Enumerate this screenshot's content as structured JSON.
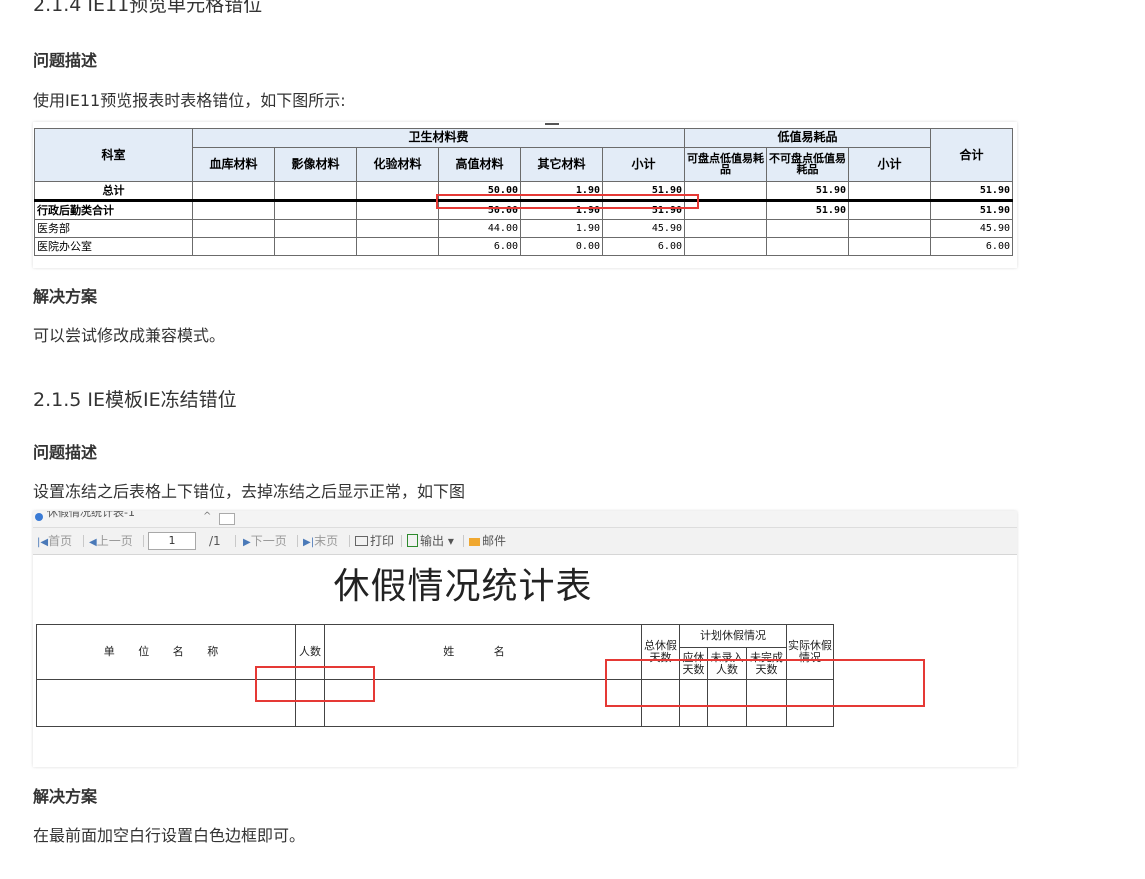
{
  "section_214": {
    "heading": "2.1.4 IE11预览单元格错位",
    "problem_heading": "问题描述",
    "problem_text": "使用IE11预览报表时表格错位，如下图所示:",
    "solution_heading": "解决方案",
    "solution_text": "可以尝试修改成兼容模式。"
  },
  "section_215": {
    "heading": "2.1.5 IE模板IE冻结错位",
    "problem_heading": "问题描述",
    "problem_text": "设置冻结之后表格上下错位，去掉冻结之后显示正常，如下图",
    "solution_heading": "解决方案",
    "solution_text": "在最前面加空白行设置白色边框即可。"
  },
  "report_table": {
    "header_dept": "科室",
    "header_health": "卫生材料费",
    "header_low": "低值易耗品",
    "header_total": "合计",
    "sub_headers": [
      "血库材料",
      "影像材料",
      "化验材料",
      "高值材料",
      "其它材料",
      "小计",
      "可盘点低值易耗品",
      "不可盘点低值易耗品",
      "小计"
    ],
    "rows": [
      {
        "name": "总计",
        "bold": true,
        "cells": [
          "",
          "",
          "",
          "50.00",
          "1.90",
          "51.90",
          "",
          "51.90",
          "",
          "51.90"
        ]
      },
      {
        "name": "行政后勤类合计",
        "bold": true,
        "cells": [
          "",
          "",
          "",
          "50.00",
          "1.90",
          "51.90",
          "",
          "51.90",
          "",
          "51.90"
        ]
      },
      {
        "name": "医务部",
        "bold": false,
        "cells": [
          "",
          "",
          "",
          "44.00",
          "1.90",
          "45.90",
          "",
          "",
          "",
          "45.90"
        ]
      },
      {
        "name": "医院办公室",
        "bold": false,
        "cells": [
          "",
          "",
          "",
          "6.00",
          "0.00",
          "6.00",
          "",
          "",
          "",
          "6.00"
        ]
      }
    ]
  },
  "leave_report": {
    "tab_title": "休假情况统计表-1",
    "toolbar": {
      "first": "首页",
      "prev": "上一页",
      "page_value": "1",
      "page_total": "/1",
      "next": "下一页",
      "last": "末页",
      "print": "打印",
      "export": "输出",
      "mail": "邮件"
    },
    "title": "休假情况统计表",
    "headers": {
      "unit_name": "单 位 名 称",
      "count": "人数",
      "name": "姓 名",
      "total_days": "总休假天数",
      "planned": "计划休假情况",
      "should_days": "应休天数",
      "not_entered": "未录入人数",
      "not_done": "未完成天数",
      "actual": "实际休假情况"
    }
  }
}
